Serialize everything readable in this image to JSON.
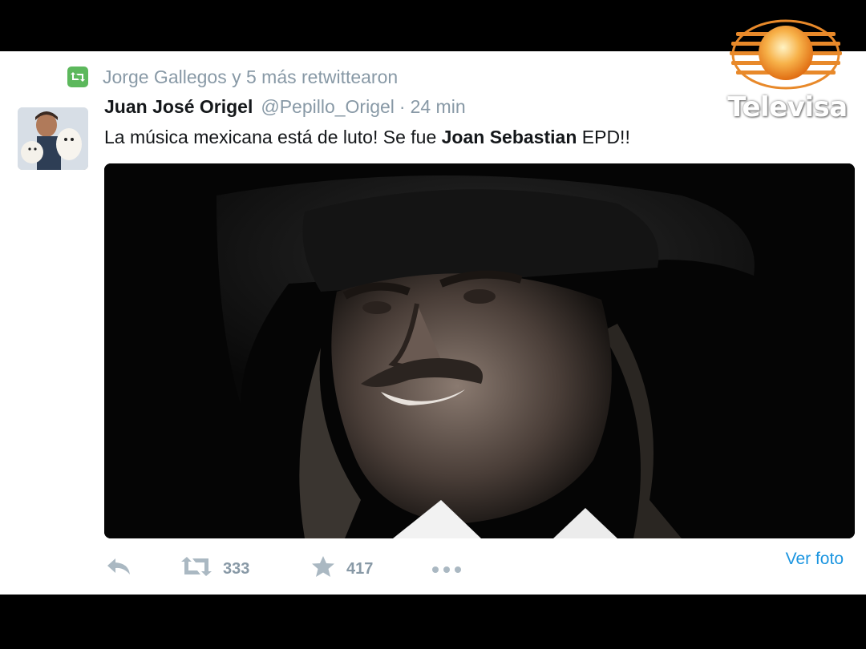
{
  "retweet": {
    "text": "Jorge Gallegos y 5 más retwittearon",
    "icon": "retweet-icon",
    "badge_color": "#5cb85c"
  },
  "tweet": {
    "display_name": "Juan José Origel",
    "handle": "@Pepillo_Origel",
    "separator": "·",
    "time": "24 min",
    "text_before": "La música mexicana está de luto! Se fue ",
    "text_bold": "Joan Sebastian",
    "text_after": " EPD!!",
    "media_alt": "Foto de Joan Sebastian con sombrero negro"
  },
  "actions": {
    "reply_icon": "reply-icon",
    "retweet_icon": "retweet-icon",
    "retweet_count": "333",
    "favorite_icon": "star-icon",
    "favorite_count": "417",
    "more_icon": "more-dots-icon",
    "view_photo": "Ver foto"
  },
  "watermark": {
    "brand": "Televisa"
  },
  "colors": {
    "link": "#1b95e0",
    "muted": "#8899a6",
    "icon_gray": "#aab8c2"
  }
}
